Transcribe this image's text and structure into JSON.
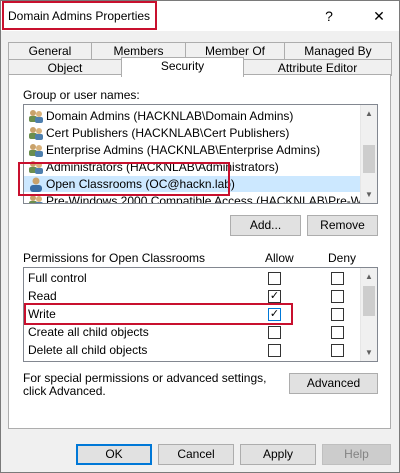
{
  "window": {
    "title": "Domain Admins Properties",
    "help_label": "?",
    "close_label": "✕"
  },
  "tabs_row1": [
    "General",
    "Members",
    "Member Of",
    "Managed By"
  ],
  "tabs_row2": [
    "Object",
    "Security",
    "Attribute Editor"
  ],
  "active_tab": "Security",
  "groups": {
    "label": "Group or user names:",
    "items": [
      {
        "name": "Domain Admins (HACKNLAB\\Domain Admins)",
        "icon": "group-icon"
      },
      {
        "name": "Cert Publishers (HACKNLAB\\Cert Publishers)",
        "icon": "group-icon"
      },
      {
        "name": "Enterprise Admins (HACKNLAB\\Enterprise Admins)",
        "icon": "group-icon"
      },
      {
        "name": "Administrators (HACKNLAB\\Administrators)",
        "icon": "group-icon"
      },
      {
        "name": "Open Classrooms (OC@hackn.lab)",
        "icon": "user-icon",
        "selected": true
      },
      {
        "name": "Pre-Windows 2000 Compatible Access (HACKNLAB\\Pre-Windo...",
        "icon": "group-icon"
      }
    ],
    "add_label": "Add...",
    "remove_label": "Remove"
  },
  "permissions": {
    "label": "Permissions for Open Classrooms",
    "allow_header": "Allow",
    "deny_header": "Deny",
    "rows": [
      {
        "name": "Full control",
        "allow": false,
        "deny": false
      },
      {
        "name": "Read",
        "allow": true,
        "deny": false
      },
      {
        "name": "Write",
        "allow": true,
        "deny": false
      },
      {
        "name": "Create all child objects",
        "allow": false,
        "deny": false
      },
      {
        "name": "Delete all child objects",
        "allow": false,
        "deny": false
      }
    ]
  },
  "advanced": {
    "text": "For special permissions or advanced settings, click Advanced.",
    "button_label": "Advanced"
  },
  "footer": {
    "ok_label": "OK",
    "cancel_label": "Cancel",
    "apply_label": "Apply",
    "help_label": "Help"
  },
  "colors": {
    "highlight": "#c8102e",
    "selection": "#cce8ff",
    "accent": "#0078d7"
  }
}
